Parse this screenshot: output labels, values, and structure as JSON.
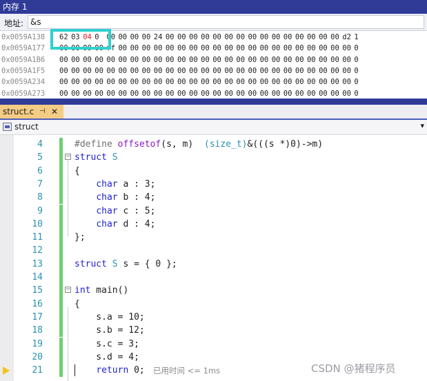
{
  "memory_window": {
    "title": "内存 1",
    "address_label": "地址:",
    "address_value": "&s",
    "rows": [
      {
        "addr": "0x0059A138",
        "bytes": [
          "62",
          "03",
          "04",
          "0",
          "00",
          "00",
          "00",
          "00",
          "24",
          "00",
          "00",
          "00",
          "00",
          "00",
          "00",
          "00",
          "00",
          "00",
          "00",
          "00",
          "00",
          "00",
          "00",
          "00",
          "d2",
          "1"
        ],
        "changed": [
          2
        ]
      },
      {
        "addr": "0x0059A177",
        "bytes": [
          "00",
          "00",
          "00",
          "00",
          "ff",
          "00",
          "00",
          "00",
          "00",
          "00",
          "00",
          "00",
          "00",
          "00",
          "00",
          "00",
          "00",
          "00",
          "00",
          "00",
          "00",
          "00",
          "00",
          "00",
          "00",
          "0"
        ],
        "changed": []
      },
      {
        "addr": "0x0059A1B6",
        "bytes": [
          "00",
          "00",
          "00",
          "00",
          "00",
          "00",
          "00",
          "00",
          "00",
          "00",
          "00",
          "00",
          "00",
          "00",
          "00",
          "00",
          "00",
          "00",
          "00",
          "00",
          "00",
          "00",
          "00",
          "00",
          "00",
          "0"
        ],
        "changed": []
      },
      {
        "addr": "0x0059A1F5",
        "bytes": [
          "00",
          "00",
          "00",
          "00",
          "00",
          "00",
          "00",
          "00",
          "00",
          "00",
          "00",
          "00",
          "00",
          "00",
          "00",
          "00",
          "00",
          "00",
          "00",
          "00",
          "00",
          "00",
          "00",
          "00",
          "00",
          "0"
        ],
        "changed": []
      },
      {
        "addr": "0x0059A234",
        "bytes": [
          "00",
          "00",
          "00",
          "00",
          "00",
          "00",
          "00",
          "00",
          "00",
          "00",
          "00",
          "00",
          "00",
          "00",
          "00",
          "00",
          "00",
          "00",
          "00",
          "00",
          "00",
          "00",
          "00",
          "00",
          "00",
          "0"
        ],
        "changed": []
      },
      {
        "addr": "0x0059A273",
        "bytes": [
          "00",
          "00",
          "00",
          "00",
          "00",
          "00",
          "00",
          "00",
          "00",
          "00",
          "00",
          "00",
          "00",
          "00",
          "00",
          "00",
          "00",
          "00",
          "00",
          "00",
          "00",
          "00",
          "00",
          "00",
          "00",
          "0"
        ],
        "changed": []
      }
    ]
  },
  "editor_tab": {
    "file_name": "struct.c",
    "pin_glyph": "⊣",
    "close_glyph": "✕"
  },
  "navigation_bar": {
    "scope": "struct",
    "dropdown_glyph": "▾"
  },
  "code_lines": [
    {
      "num": "4",
      "parts": [
        [
          "pp",
          "#define "
        ],
        [
          "macro",
          "offsetof"
        ],
        [
          "",
          "(s, m)  "
        ],
        [
          "typ",
          "(size_t)"
        ],
        [
          "",
          "&(((s *)0)->m)"
        ]
      ]
    },
    {
      "num": "5",
      "fold": "−",
      "parts": [
        [
          "kw",
          "struct "
        ],
        [
          "typ",
          "S"
        ]
      ]
    },
    {
      "num": "6",
      "parts": [
        [
          "",
          "{"
        ]
      ]
    },
    {
      "num": "7",
      "parts": [
        [
          "",
          "    "
        ],
        [
          "kw",
          "char"
        ],
        [
          "",
          " a : 3;"
        ]
      ]
    },
    {
      "num": "8",
      "parts": [
        [
          "",
          "    "
        ],
        [
          "kw",
          "char"
        ],
        [
          "",
          " b : 4;"
        ]
      ]
    },
    {
      "num": "9",
      "parts": [
        [
          "",
          "    "
        ],
        [
          "kw",
          "char"
        ],
        [
          "",
          " c : 5;"
        ]
      ]
    },
    {
      "num": "10",
      "parts": [
        [
          "",
          "    "
        ],
        [
          "kw",
          "char"
        ],
        [
          "",
          " d : 4;"
        ]
      ]
    },
    {
      "num": "11",
      "parts": [
        [
          "",
          "};"
        ]
      ]
    },
    {
      "num": "12",
      "parts": [
        [
          "",
          ""
        ]
      ]
    },
    {
      "num": "13",
      "parts": [
        [
          "kw",
          "struct "
        ],
        [
          "typ",
          "S"
        ],
        [
          "",
          " s = { 0 };"
        ]
      ]
    },
    {
      "num": "14",
      "parts": [
        [
          "",
          ""
        ]
      ]
    },
    {
      "num": "15",
      "fold": "−",
      "parts": [
        [
          "kw",
          "int"
        ],
        [
          "",
          " main()"
        ]
      ]
    },
    {
      "num": "16",
      "parts": [
        [
          "",
          "{"
        ]
      ]
    },
    {
      "num": "17",
      "parts": [
        [
          "",
          "    s.a = 10;"
        ]
      ]
    },
    {
      "num": "18",
      "parts": [
        [
          "",
          "    s.b = 12;"
        ]
      ]
    },
    {
      "num": "19",
      "parts": [
        [
          "",
          "    s.c = 3;"
        ]
      ]
    },
    {
      "num": "20",
      "parts": [
        [
          "",
          "    s.d = 4;"
        ]
      ]
    },
    {
      "num": "21",
      "parts": [
        [
          "",
          "    "
        ],
        [
          "kw",
          "return"
        ],
        [
          "",
          " 0;"
        ]
      ]
    }
  ],
  "perf_tip": "已用时间 <= 1ms",
  "watermark": "CSDN @猪程序员"
}
